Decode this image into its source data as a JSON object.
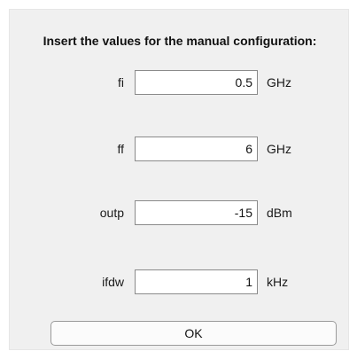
{
  "dialog": {
    "heading": "Insert the values for the manual configuration:",
    "fields": [
      {
        "label": "fi",
        "value": "0.5",
        "unit": "GHz"
      },
      {
        "label": "ff",
        "value": "6",
        "unit": "GHz"
      },
      {
        "label": "outp",
        "value": "-15",
        "unit": "dBm"
      },
      {
        "label": "ifdw",
        "value": "1",
        "unit": "kHz"
      }
    ],
    "ok_label": "OK"
  }
}
